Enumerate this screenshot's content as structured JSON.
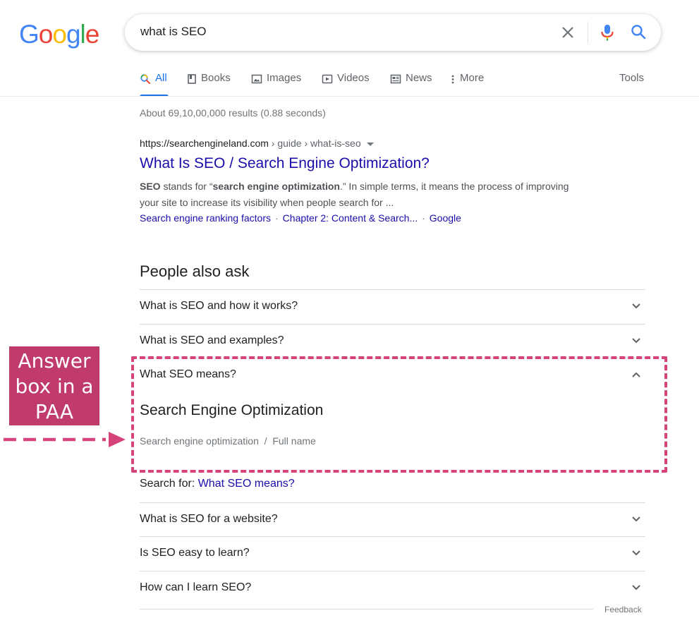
{
  "logo": {
    "letters": [
      "G",
      "o",
      "o",
      "g",
      "l",
      "e"
    ],
    "colors": [
      "#4285f4",
      "#ea4335",
      "#fbbc05",
      "#4285f4",
      "#34a853",
      "#ea4335"
    ]
  },
  "search": {
    "query": "what is SEO"
  },
  "tabs": [
    {
      "label": "All",
      "icon": "search-icon",
      "active": true
    },
    {
      "label": "Books",
      "icon": "book-icon"
    },
    {
      "label": "Images",
      "icon": "image-icon"
    },
    {
      "label": "Videos",
      "icon": "video-icon"
    },
    {
      "label": "News",
      "icon": "news-icon"
    },
    {
      "label": "More",
      "icon": "more-vertical-icon"
    }
  ],
  "tools_label": "Tools",
  "stats": "About 69,10,00,000 results (0.88 seconds)",
  "result": {
    "domain": "https://searchengineland.com",
    "breadcrumb": " › guide › what-is-seo",
    "title": "What Is SEO / Search Engine Optimization?",
    "snippet_parts": [
      {
        "text": "SEO",
        "bold": true
      },
      {
        "text": " stands for “",
        "bold": false
      },
      {
        "text": "search engine optimization",
        "bold": true
      },
      {
        "text": ".” In simple terms, it means the process of improving your site to increase its visibility when people search for ...",
        "bold": false
      }
    ],
    "sitelinks": [
      "Search engine ranking factors",
      "Chapter 2: Content & Search...",
      "Google"
    ]
  },
  "paa": {
    "heading": "People also ask",
    "questions": [
      "What is SEO and how it works?",
      "What is SEO and examples?",
      "What SEO means?",
      "What is SEO for a website?",
      "Is SEO easy to learn?",
      "How can I learn SEO?"
    ],
    "expanded_index": 2,
    "answer_title": "Search Engine Optimization",
    "answer_sub": "Search engine optimization  /  Full name",
    "search_for_label": "Search for: ",
    "search_for_link": "What SEO means?"
  },
  "feedback_label": "Feedback",
  "annotation": {
    "lines": [
      "Answer",
      "box in a",
      "PAA"
    ],
    "color": "#c13a6c",
    "dash_color": "#d6437a"
  },
  "colors": {
    "link": "#1a0dab",
    "tab_active": "#1a73e8",
    "muted": "#70757a"
  }
}
